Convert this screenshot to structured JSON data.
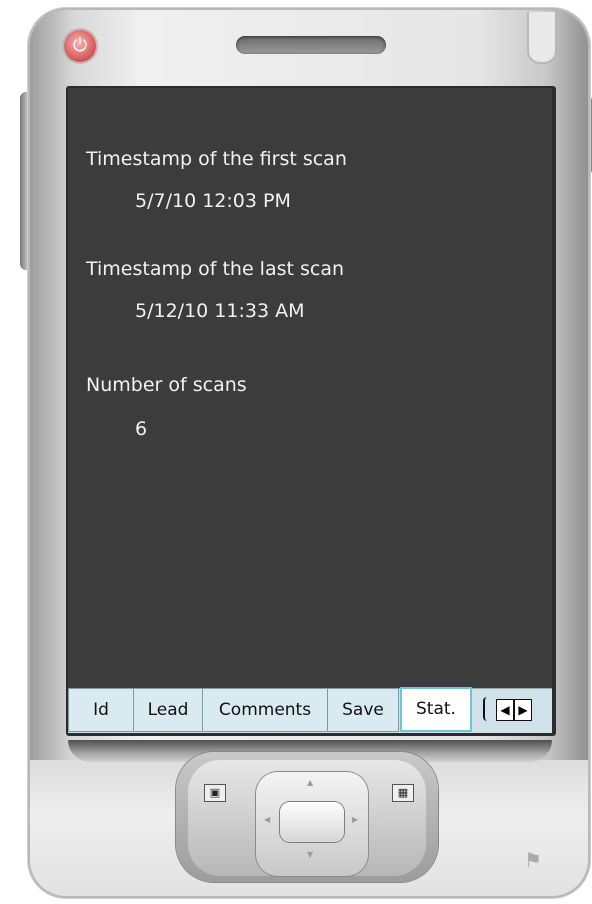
{
  "device": {
    "power_icon": "power-icon",
    "logo_icon": "windows-flag-icon"
  },
  "stats": {
    "first_scan_label": "Timestamp of the first scan",
    "first_scan_value": "5/7/10 12:03 PM",
    "last_scan_label": "Timestamp of the last scan",
    "last_scan_value": "5/12/10 11:33 AM",
    "count_label": "Number of scans",
    "count_value": "6"
  },
  "tabs": [
    {
      "label": "Id"
    },
    {
      "label": "Lead"
    },
    {
      "label": "Comments"
    },
    {
      "label": "Save"
    },
    {
      "label": "Stat.",
      "active": true
    }
  ],
  "tab_scroll": {
    "left_icon": "chevron-left-icon",
    "right_icon": "chevron-right-icon"
  },
  "colors": {
    "screen_bg": "#3c3c3c",
    "text": "#f2f2f2",
    "tab_bg": "#d9ebf1",
    "active_tab_border": "#6fc6d8"
  }
}
